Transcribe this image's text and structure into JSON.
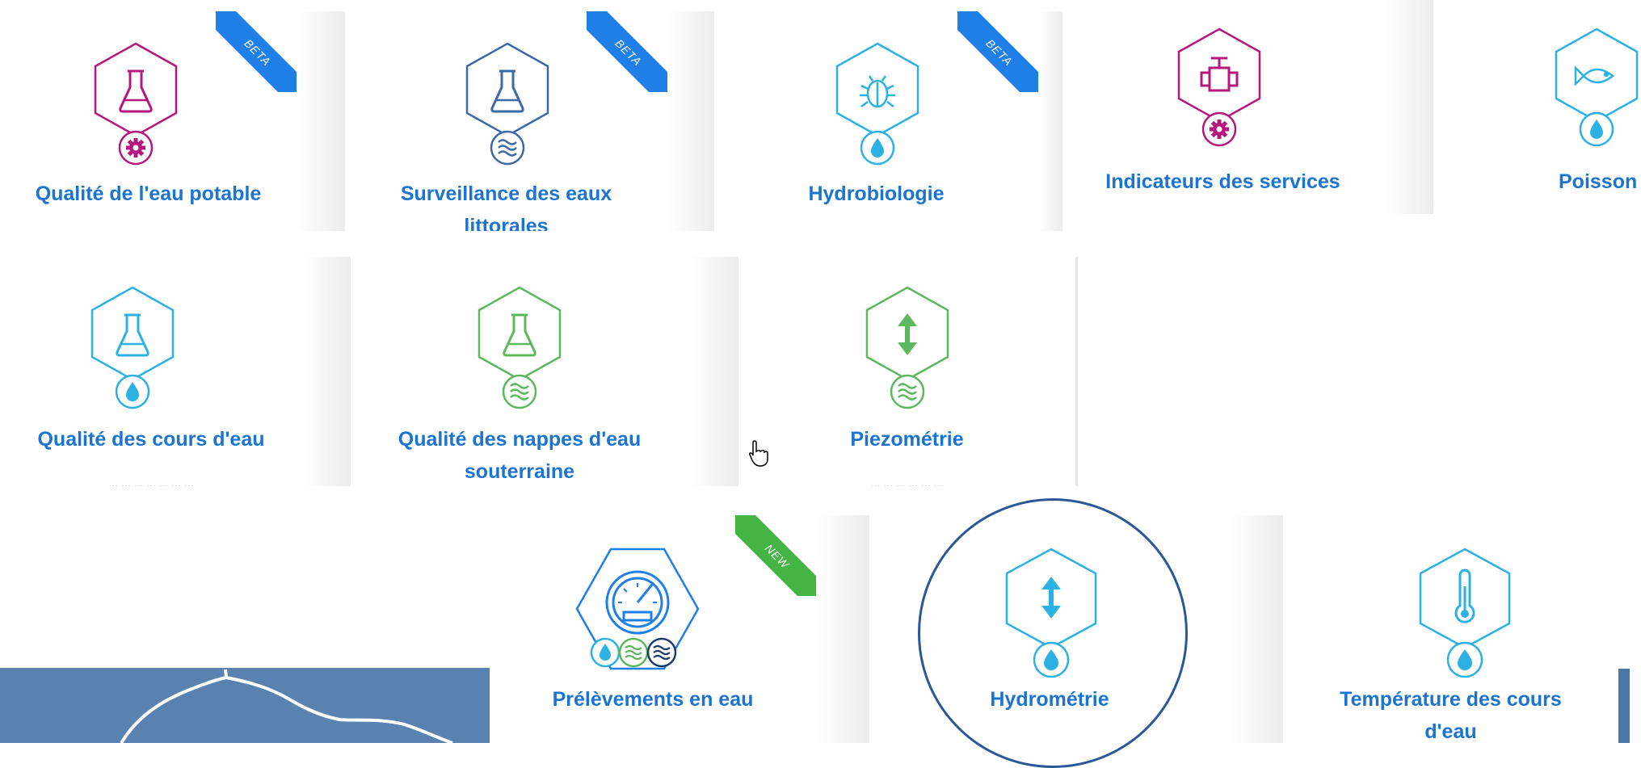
{
  "tiles": {
    "qualite_eau_potable": {
      "title": "Qualité de l'eau potable",
      "badge": "BETA"
    },
    "surveillance_eaux_littorales": {
      "title": "Surveillance des eaux littorales",
      "badge": "BETA"
    },
    "hydrobiologie": {
      "title": "Hydrobiologie",
      "badge": "BETA"
    },
    "indicateurs_services": {
      "title": "Indicateurs des services"
    },
    "poisson": {
      "title": "Poisson"
    },
    "qualite_cours_eau": {
      "title": "Qualité des cours d'eau",
      "desc": "... ... ... ... ... ... ..."
    },
    "qualite_nappes": {
      "title": "Qualité des nappes d'eau souterraine"
    },
    "piezometrie": {
      "title": "Piezométrie",
      "desc": "... ... ... ... ... ..."
    },
    "prelevements": {
      "title": "Prélèvements en eau",
      "badge": "NEW"
    },
    "hydrometrie": {
      "title": "Hydrométrie"
    },
    "temperature": {
      "title": "Température des cours d'eau"
    }
  },
  "colors": {
    "magenta": "#b5177d",
    "navy": "#3c6aa8",
    "cyan": "#2bb1e2",
    "green": "#5cb85c",
    "blue": "#1e7fe6",
    "beta_ribbon": "#1e7fe6",
    "new_ribbon": "#44b544",
    "title": "#1b75d0"
  },
  "icons": {
    "flask": "flask-icon",
    "gear": "gear-icon",
    "waves": "waves-icon",
    "drop": "drop-icon",
    "bug": "bug-icon",
    "valve": "valve-icon",
    "fish": "fish-icon",
    "updown": "up-down-arrow-icon",
    "gauge": "gauge-icon",
    "thermometer": "thermometer-icon"
  }
}
